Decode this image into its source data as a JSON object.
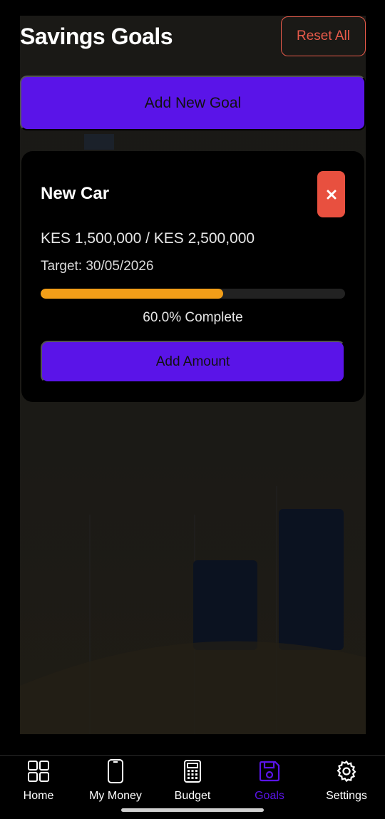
{
  "header": {
    "title": "Savings Goals",
    "reset_label": "Reset All"
  },
  "actions": {
    "add_goal_label": "Add New Goal"
  },
  "goal": {
    "name": "New Car",
    "amount_text": "KES 1,500,000 / KES 2,500,000",
    "target_text": "Target: 30/05/2026",
    "progress_fraction": 0.6,
    "progress_text": "60.0% Complete",
    "add_amount_label": "Add Amount",
    "delete_icon": "close-icon"
  },
  "colors": {
    "accent": "#5a14e8",
    "danger": "#e8503f",
    "progress": "#f29e18"
  },
  "nav": {
    "items": [
      {
        "label": "Home",
        "icon": "grid-icon",
        "active": false
      },
      {
        "label": "My Money",
        "icon": "phone-icon",
        "active": false
      },
      {
        "label": "Budget",
        "icon": "calculator-icon",
        "active": false
      },
      {
        "label": "Goals",
        "icon": "save-icon",
        "active": true
      },
      {
        "label": "Settings",
        "icon": "gear-icon",
        "active": false
      }
    ]
  }
}
